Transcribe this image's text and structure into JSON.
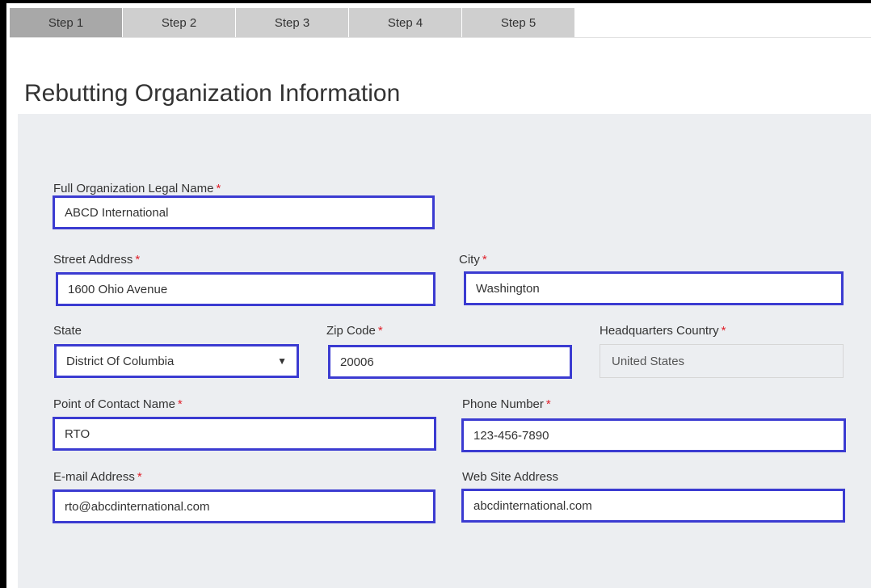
{
  "tabs": [
    "Step 1",
    "Step 2",
    "Step 3",
    "Step 4",
    "Step 5"
  ],
  "page_title": "Rebutting Organization Information",
  "required_mark": "*",
  "fields": {
    "org_name": {
      "label": "Full Organization Legal Name",
      "value": "ABCD International"
    },
    "street": {
      "label": "Street Address",
      "value": "1600 Ohio Avenue"
    },
    "city": {
      "label": "City",
      "value": "Washington"
    },
    "state": {
      "label": "State",
      "value": "District Of Columbia"
    },
    "zip": {
      "label": "Zip Code",
      "value": "20006"
    },
    "country": {
      "label": "Headquarters Country",
      "value": "United States"
    },
    "contact": {
      "label": "Point of Contact Name",
      "value": "RTO"
    },
    "phone": {
      "label": "Phone Number",
      "value": "123-456-7890"
    },
    "email": {
      "label": "E-mail Address",
      "value": "rto@abcdinternational.com"
    },
    "website": {
      "label": "Web Site Address",
      "value": "abcdinternational.com"
    }
  },
  "icons": {
    "state_dropdown": "triangle-down-icon"
  },
  "colors": {
    "focus_border": "#3b3bd1",
    "required": "#e0202a",
    "panel_bg": "#eceef1",
    "tab_active": "#a8a8a8",
    "tab_inactive": "#cfcfcf"
  }
}
